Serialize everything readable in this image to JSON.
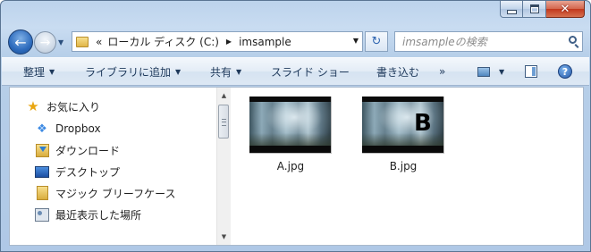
{
  "address": {
    "overflow_chevron": "«",
    "path": [
      "ローカル ディスク (C:)",
      "imsample"
    ]
  },
  "search": {
    "placeholder": "imsampleの検索"
  },
  "toolbar": {
    "organize": "整理",
    "add_to_library": "ライブラリに追加",
    "share": "共有",
    "slideshow": "スライド ショー",
    "burn": "書き込む",
    "more": "»"
  },
  "nav": {
    "favorites": "お気に入り",
    "items": [
      {
        "label": "Dropbox",
        "icon": "dropbox-icon"
      },
      {
        "label": "ダウンロード",
        "icon": "download-folder-icon"
      },
      {
        "label": "デスクトップ",
        "icon": "desktop-icon"
      },
      {
        "label": "マジック ブリーフケース",
        "icon": "folder-icon"
      },
      {
        "label": "最近表示した場所",
        "icon": "recent-places-icon"
      }
    ]
  },
  "files": [
    {
      "name": "A.jpg",
      "overlay": ""
    },
    {
      "name": "B.jpg",
      "overlay": "B"
    }
  ],
  "colors": {
    "accent": "#2f65b0",
    "close_button": "#c2381c",
    "toolbar_text": "#1e395b"
  }
}
